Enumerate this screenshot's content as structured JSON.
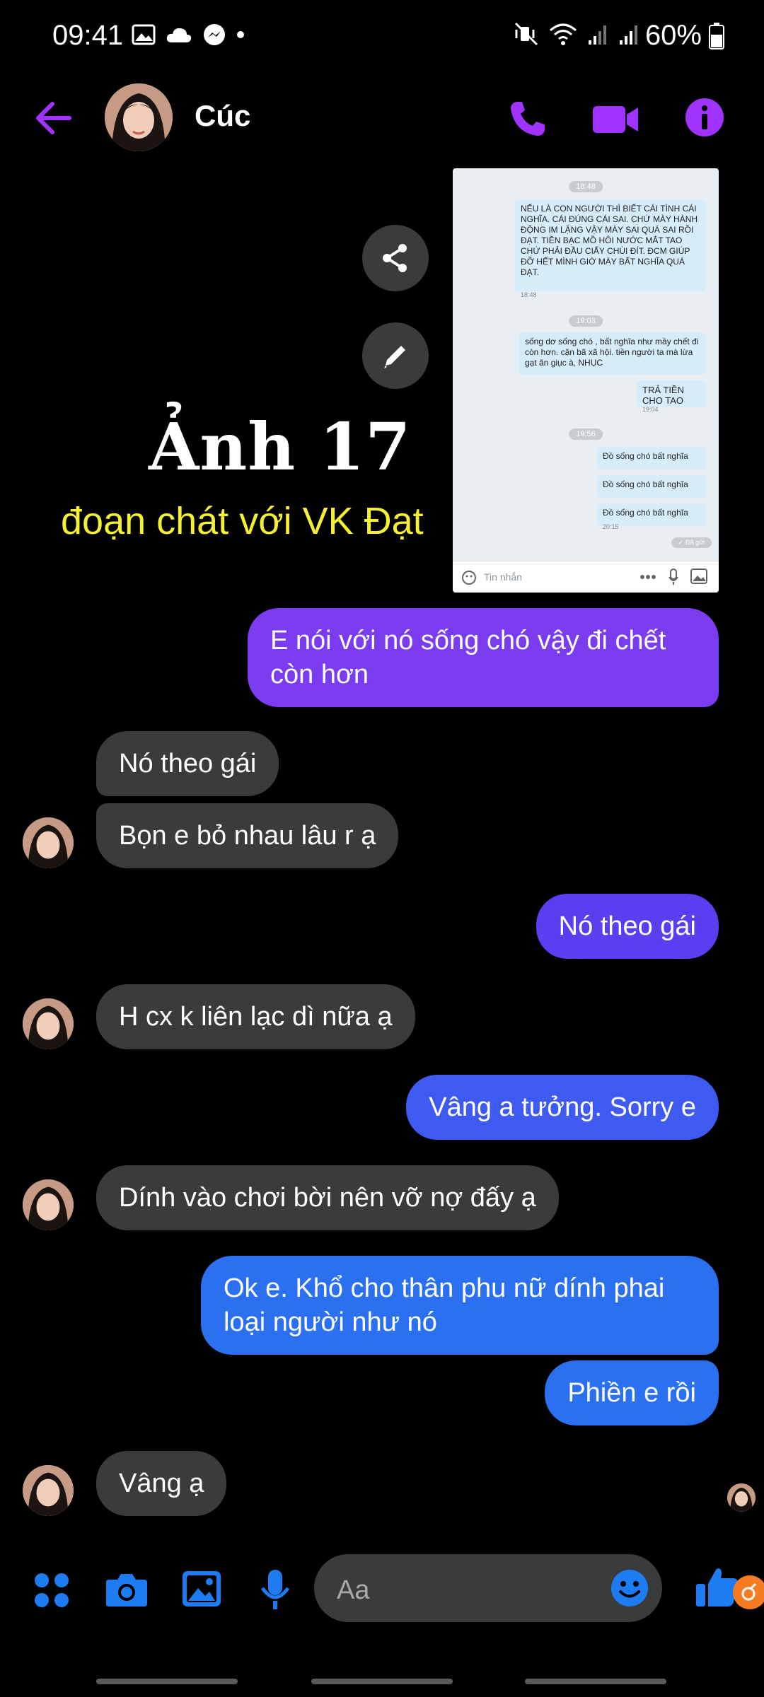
{
  "status_bar": {
    "time": "09:41",
    "battery": "60%"
  },
  "header": {
    "contact_name": "Cúc"
  },
  "shared_image": {
    "timestamps": [
      "18:48",
      "19:03",
      "19:56"
    ],
    "messages": [
      {
        "text": "NẾU LÀ CON NGƯỜI THÌ BIẾT CÁI TÌNH CÁI NGHĨA. CÁI ĐÚNG CÁI SAI. CHỨ MÀY HÀNH ĐỘNG IM LẶNG VẬY MÀY SAI QUÁ SAI RỒI ĐẠT. TIỀN BẠC MỒ HÔI NƯỚC MẮT TAO CHỨ PHẢI ĐẦU CIẤY CHÙI ĐÍT. ĐCM GIÚP ĐỠ HẾT MÌNH GIỜ MÀY BẤT NGHĨA QUÁ ĐẠT.",
        "time": "18:48"
      },
      {
        "text": "sống dơ sống chó , bất nghĩa như mầy chết đi còn hơn. cặn bã xã hội. tiền người ta mà lừa gạt ăn giục à, NHỤC",
        "time": ""
      },
      {
        "text": "TRẢ TIỀN CHO TAO",
        "time": "19:04"
      },
      {
        "text": "Đồ sống chó bất nghĩa",
        "time": ""
      },
      {
        "text": "Đồ sống chó bất nghĩa",
        "time": ""
      },
      {
        "text": "Đồ sống chó bất nghĩa",
        "time": "20:15"
      }
    ],
    "seen_label": "✓ Đã gửi",
    "composer_placeholder": "Tin nhắn"
  },
  "overlay": {
    "title": "Ảnh 17",
    "subtitle": "đoạn chát với VK Đạt"
  },
  "messages": [
    {
      "from": "me",
      "text": "E nói với nó sống chó vậy đi chết còn hơn"
    },
    {
      "from": "them",
      "text": "Nó theo gái"
    },
    {
      "from": "them",
      "text": "Bọn e bỏ nhau lâu r ạ"
    },
    {
      "from": "me",
      "text": "Nó theo gái"
    },
    {
      "from": "them",
      "text": "H cx k liên lạc dì nữa ạ"
    },
    {
      "from": "me",
      "text": "Vâng a tưởng. Sorry e"
    },
    {
      "from": "them",
      "text": "Dính vào chơi bời nên vỡ nợ đấy ạ"
    },
    {
      "from": "me",
      "text": "Ok e. Khổ cho thân phu nữ dính phai loại người như nó"
    },
    {
      "from": "me",
      "text": "Phiền e rồi"
    },
    {
      "from": "them",
      "text": "Vâng ạ"
    }
  ],
  "composer": {
    "placeholder": "Aa"
  },
  "colors": {
    "accent": "#a033ff",
    "bubble_out_1": "#7b3cf0",
    "bubble_out_2": "#5a3ef0",
    "bubble_out_3": "#3f5af0",
    "bubble_out_4": "#2a70f0",
    "bubble_in": "#3a3b3c",
    "composer_icon": "#1e7cf2"
  },
  "icons": {
    "back": "arrow-left-icon",
    "call": "phone-icon",
    "video": "video-camera-icon",
    "info": "info-icon",
    "share": "share-icon",
    "edit": "pencil-icon",
    "apps": "four-dots-icon",
    "camera": "camera-icon",
    "gallery": "image-icon",
    "mic": "microphone-icon",
    "emoji": "emoji-icon",
    "like": "thumbs-up-icon"
  }
}
